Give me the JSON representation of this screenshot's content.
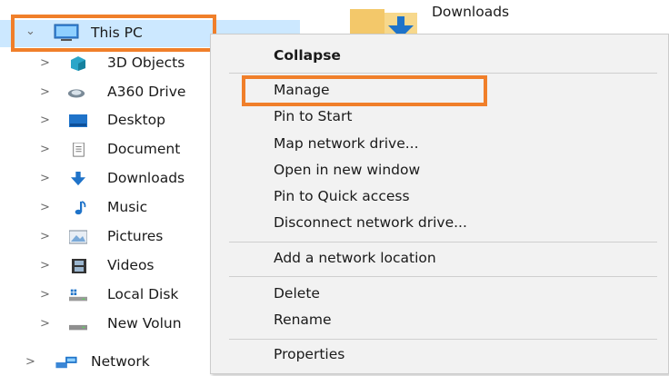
{
  "tree": {
    "this_pc": "This PC",
    "items": [
      "3D Objects",
      "A360 Drive",
      "Desktop",
      "Document",
      "Downloads",
      "Music",
      "Pictures",
      "Videos",
      "Local Disk",
      "New Volun"
    ],
    "network": "Network"
  },
  "content": {
    "folder_label": "Downloads"
  },
  "context_menu": {
    "header": "Collapse",
    "group1": [
      "Manage",
      "Pin to Start",
      "Map network drive...",
      "Open in new window",
      "Pin to Quick access",
      "Disconnect network drive..."
    ],
    "group2": [
      "Add a network location"
    ],
    "group3": [
      "Delete",
      "Rename"
    ],
    "group4": [
      "Properties"
    ]
  },
  "colors": {
    "highlight": "#f07f2a",
    "selection": "#cce8ff",
    "menu_bg": "#f2f2f2"
  }
}
